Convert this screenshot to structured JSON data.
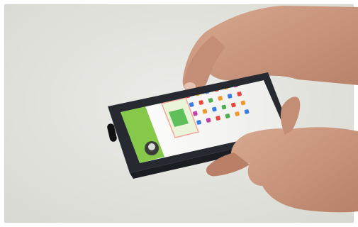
{
  "scene": {
    "subject": "hands-holding-smartphone",
    "background_color": "#e6e6e2",
    "skin_color": "#c9987f",
    "phone_frame_color": "#262a30",
    "screen_accent_green": "#86c84a",
    "screen_background": "#f5f5f3"
  },
  "app_icon_colors": [
    "#e8483c",
    "#f09a2b",
    "#3a7de0",
    "#e8483c",
    "#f09a2b",
    "#c33fa6",
    "#3a7de0",
    "#e8483c",
    "#4cae4f",
    "#f09a2b",
    "#3a7de0",
    "#e8483c",
    "#c33fa6",
    "#f09a2b",
    "#3a7de0",
    "#4cae4f",
    "#e8483c",
    "#f09a2b",
    "#3a7de0",
    "#c33fa6",
    "#e8483c",
    "#4cae4f",
    "#f09a2b",
    "#3a7de0"
  ]
}
